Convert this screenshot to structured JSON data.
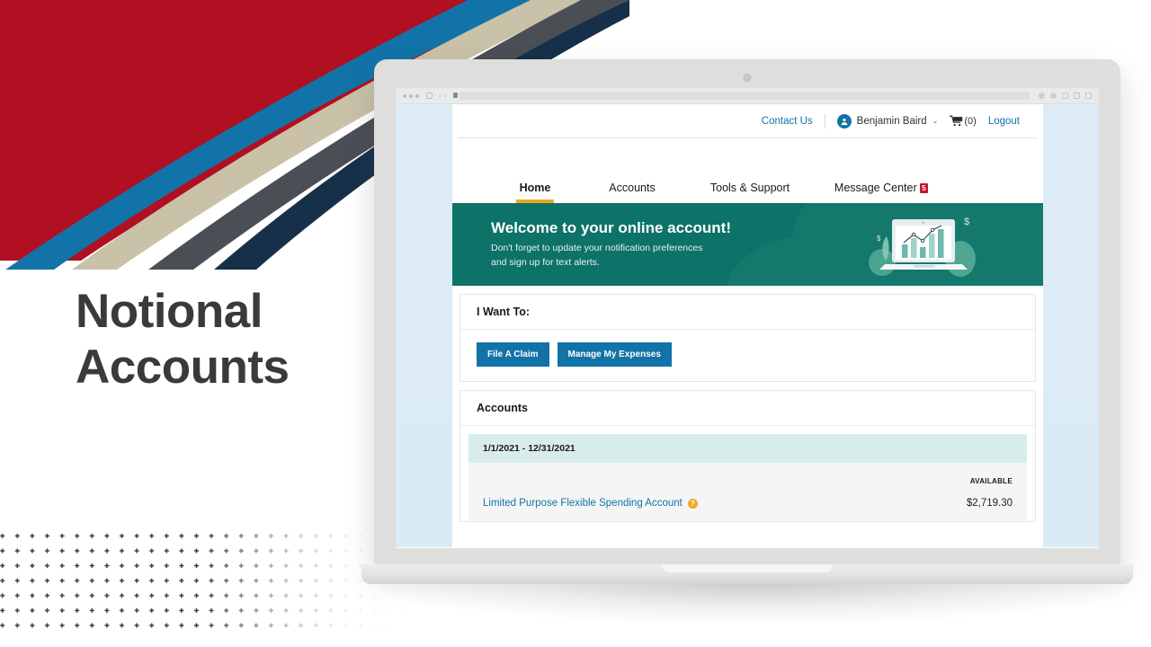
{
  "slide": {
    "headline_line1": "Notional",
    "headline_line2": "Accounts",
    "colors": {
      "red": "#b01022",
      "blue": "#1273a8",
      "tan": "#c9c2a8",
      "gray": "#4a4f55",
      "navy": "#17304a",
      "teal": "#0d7268",
      "gold": "#e8aa22"
    }
  },
  "browser": {
    "url_placeholder": ""
  },
  "utility_bar": {
    "contact_us": "Contact Us",
    "user_name": "Benjamin Baird",
    "user_caret": "⌄",
    "cart_count": "(0)",
    "logout": "Logout"
  },
  "main_nav": {
    "items": [
      {
        "label": "Home",
        "active": true
      },
      {
        "label": "Accounts",
        "active": false
      },
      {
        "label": "Tools & Support",
        "active": false
      },
      {
        "label": "Message Center",
        "active": false,
        "badge": "5"
      }
    ]
  },
  "hero": {
    "title": "Welcome to your online account!",
    "subtitle_line1": "Don't forget to update your notification preferences",
    "subtitle_line2": "and sign up for text alerts."
  },
  "i_want_to": {
    "heading": "I Want To:",
    "buttons": [
      {
        "label": "File A Claim"
      },
      {
        "label": "Manage My Expenses"
      }
    ]
  },
  "accounts": {
    "heading": "Accounts",
    "period": "1/1/2021 - 12/31/2021",
    "column_header": "AVAILABLE",
    "rows": [
      {
        "name": "Limited Purpose Flexible Spending Account",
        "help_icon": "?",
        "available": "$2,719.30"
      }
    ]
  }
}
